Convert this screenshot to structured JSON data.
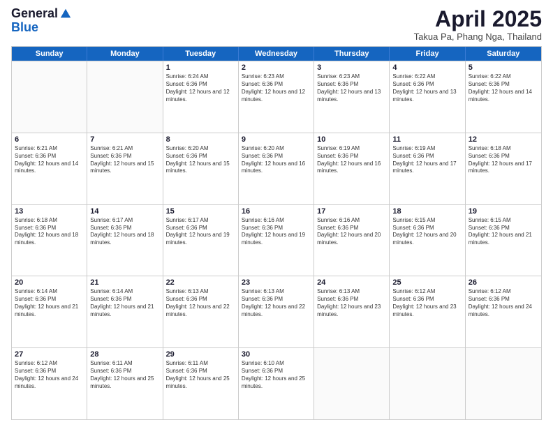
{
  "header": {
    "logo_general": "General",
    "logo_blue": "Blue",
    "month_title": "April 2025",
    "location": "Takua Pa, Phang Nga, Thailand"
  },
  "calendar": {
    "days_of_week": [
      "Sunday",
      "Monday",
      "Tuesday",
      "Wednesday",
      "Thursday",
      "Friday",
      "Saturday"
    ],
    "weeks": [
      [
        {
          "day": "",
          "empty": true
        },
        {
          "day": "",
          "empty": true
        },
        {
          "day": "1",
          "sunrise": "6:24 AM",
          "sunset": "6:36 PM",
          "daylight": "12 hours and 12 minutes."
        },
        {
          "day": "2",
          "sunrise": "6:23 AM",
          "sunset": "6:36 PM",
          "daylight": "12 hours and 12 minutes."
        },
        {
          "day": "3",
          "sunrise": "6:23 AM",
          "sunset": "6:36 PM",
          "daylight": "12 hours and 13 minutes."
        },
        {
          "day": "4",
          "sunrise": "6:22 AM",
          "sunset": "6:36 PM",
          "daylight": "12 hours and 13 minutes."
        },
        {
          "day": "5",
          "sunrise": "6:22 AM",
          "sunset": "6:36 PM",
          "daylight": "12 hours and 14 minutes."
        }
      ],
      [
        {
          "day": "6",
          "sunrise": "6:21 AM",
          "sunset": "6:36 PM",
          "daylight": "12 hours and 14 minutes."
        },
        {
          "day": "7",
          "sunrise": "6:21 AM",
          "sunset": "6:36 PM",
          "daylight": "12 hours and 15 minutes."
        },
        {
          "day": "8",
          "sunrise": "6:20 AM",
          "sunset": "6:36 PM",
          "daylight": "12 hours and 15 minutes."
        },
        {
          "day": "9",
          "sunrise": "6:20 AM",
          "sunset": "6:36 PM",
          "daylight": "12 hours and 16 minutes."
        },
        {
          "day": "10",
          "sunrise": "6:19 AM",
          "sunset": "6:36 PM",
          "daylight": "12 hours and 16 minutes."
        },
        {
          "day": "11",
          "sunrise": "6:19 AM",
          "sunset": "6:36 PM",
          "daylight": "12 hours and 17 minutes."
        },
        {
          "day": "12",
          "sunrise": "6:18 AM",
          "sunset": "6:36 PM",
          "daylight": "12 hours and 17 minutes."
        }
      ],
      [
        {
          "day": "13",
          "sunrise": "6:18 AM",
          "sunset": "6:36 PM",
          "daylight": "12 hours and 18 minutes."
        },
        {
          "day": "14",
          "sunrise": "6:17 AM",
          "sunset": "6:36 PM",
          "daylight": "12 hours and 18 minutes."
        },
        {
          "day": "15",
          "sunrise": "6:17 AM",
          "sunset": "6:36 PM",
          "daylight": "12 hours and 19 minutes."
        },
        {
          "day": "16",
          "sunrise": "6:16 AM",
          "sunset": "6:36 PM",
          "daylight": "12 hours and 19 minutes."
        },
        {
          "day": "17",
          "sunrise": "6:16 AM",
          "sunset": "6:36 PM",
          "daylight": "12 hours and 20 minutes."
        },
        {
          "day": "18",
          "sunrise": "6:15 AM",
          "sunset": "6:36 PM",
          "daylight": "12 hours and 20 minutes."
        },
        {
          "day": "19",
          "sunrise": "6:15 AM",
          "sunset": "6:36 PM",
          "daylight": "12 hours and 21 minutes."
        }
      ],
      [
        {
          "day": "20",
          "sunrise": "6:14 AM",
          "sunset": "6:36 PM",
          "daylight": "12 hours and 21 minutes."
        },
        {
          "day": "21",
          "sunrise": "6:14 AM",
          "sunset": "6:36 PM",
          "daylight": "12 hours and 21 minutes."
        },
        {
          "day": "22",
          "sunrise": "6:13 AM",
          "sunset": "6:36 PM",
          "daylight": "12 hours and 22 minutes."
        },
        {
          "day": "23",
          "sunrise": "6:13 AM",
          "sunset": "6:36 PM",
          "daylight": "12 hours and 22 minutes."
        },
        {
          "day": "24",
          "sunrise": "6:13 AM",
          "sunset": "6:36 PM",
          "daylight": "12 hours and 23 minutes."
        },
        {
          "day": "25",
          "sunrise": "6:12 AM",
          "sunset": "6:36 PM",
          "daylight": "12 hours and 23 minutes."
        },
        {
          "day": "26",
          "sunrise": "6:12 AM",
          "sunset": "6:36 PM",
          "daylight": "12 hours and 24 minutes."
        }
      ],
      [
        {
          "day": "27",
          "sunrise": "6:12 AM",
          "sunset": "6:36 PM",
          "daylight": "12 hours and 24 minutes."
        },
        {
          "day": "28",
          "sunrise": "6:11 AM",
          "sunset": "6:36 PM",
          "daylight": "12 hours and 25 minutes."
        },
        {
          "day": "29",
          "sunrise": "6:11 AM",
          "sunset": "6:36 PM",
          "daylight": "12 hours and 25 minutes."
        },
        {
          "day": "30",
          "sunrise": "6:10 AM",
          "sunset": "6:36 PM",
          "daylight": "12 hours and 25 minutes."
        },
        {
          "day": "",
          "empty": true
        },
        {
          "day": "",
          "empty": true
        },
        {
          "day": "",
          "empty": true
        }
      ]
    ]
  }
}
